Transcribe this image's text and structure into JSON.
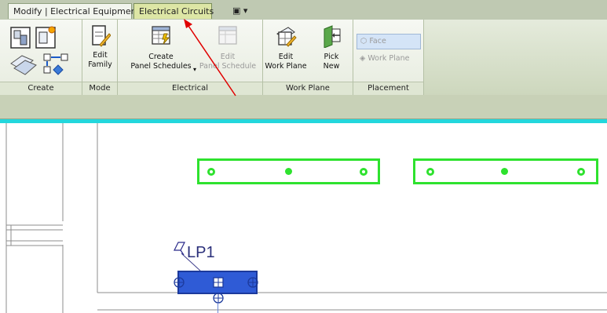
{
  "tabs": {
    "modify": "Modify | Electrical Equipment",
    "circuits": "Electrical Circuits",
    "extra": "▣ ▾"
  },
  "ribbon": {
    "create": {
      "label": "Create"
    },
    "mode": {
      "label": "Mode",
      "edit_family": [
        "Edit",
        "Family"
      ]
    },
    "electrical": {
      "label": "Electrical",
      "create_panel": [
        "Create",
        "Panel Schedules"
      ],
      "edit_panel": [
        "Edit",
        "Panel Schedule"
      ]
    },
    "workplane": {
      "label": "Work Plane",
      "edit_wp": [
        "Edit",
        "Work Plane"
      ],
      "pick_new": [
        "Pick",
        "New"
      ]
    },
    "placement": {
      "label": "Placement",
      "face": "Face",
      "work_plane": "Work Plane"
    }
  },
  "canvas": {
    "tag": "LP1"
  },
  "colors": {
    "fixture": "#2ee22e",
    "panel": "#2f5bd6",
    "accent_line": "#23d7dc",
    "arrow": "#e00000"
  },
  "icons": [
    "load-family-icon",
    "in-place-icon",
    "model-icon",
    "edit-family-icon",
    "create-panel-schedule-icon",
    "edit-panel-schedule-icon",
    "edit-work-plane-icon",
    "pick-new-icon",
    "face-icon",
    "work-plane-icon"
  ]
}
